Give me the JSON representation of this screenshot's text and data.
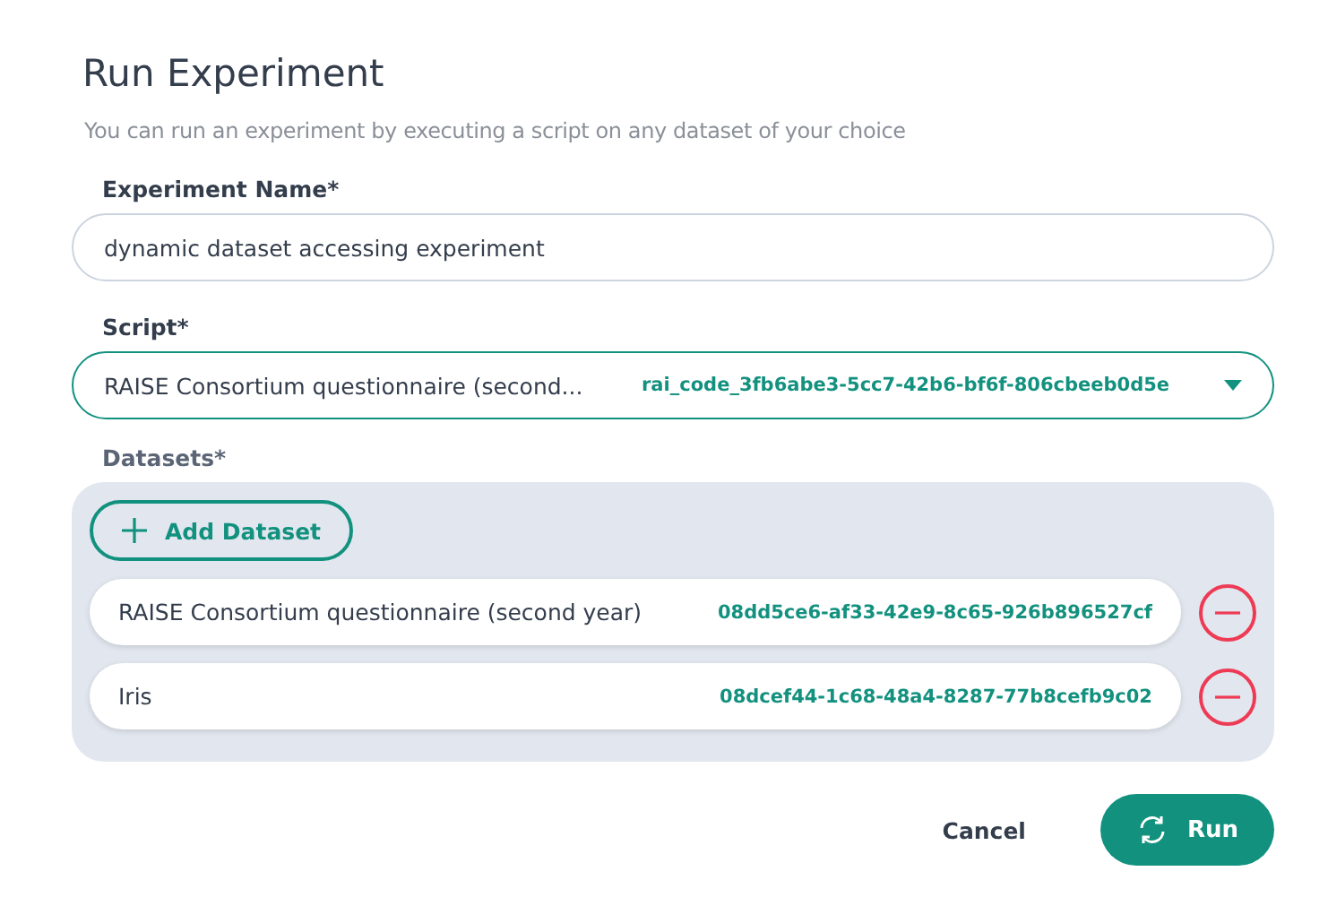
{
  "dialog": {
    "title": "Run Experiment",
    "subtitle": "You can run an experiment by executing a script on any dataset of your choice"
  },
  "experiment_name": {
    "label": "Experiment Name*",
    "value": "dynamic dataset accessing experiment"
  },
  "script": {
    "label": "Script*",
    "value": "RAISE Consortium questionnaire (second...",
    "code": "rai_code_3fb6abe3-5cc7-42b6-bf6f-806cbeeb0d5e"
  },
  "datasets": {
    "label": "Datasets*",
    "add_button": "Add Dataset",
    "items": [
      {
        "name": "RAISE Consortium questionnaire (second year)",
        "id": "08dd5ce6-af33-42e9-8c65-926b896527cf"
      },
      {
        "name": "Iris",
        "id": "08dcef44-1c68-48a4-8287-77b8cefb9c02"
      }
    ]
  },
  "buttons": {
    "cancel": "Cancel",
    "run": "Run"
  }
}
